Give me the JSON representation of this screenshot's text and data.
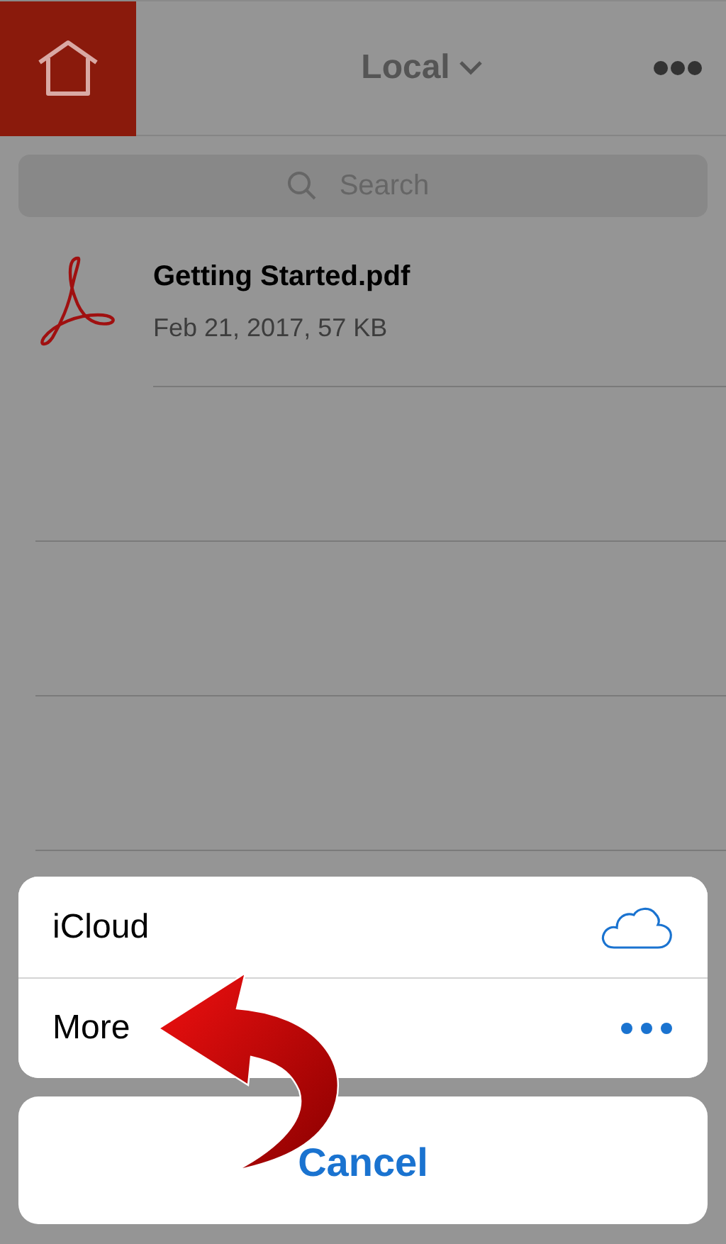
{
  "header": {
    "title": "Local"
  },
  "search": {
    "placeholder": "Search"
  },
  "files": [
    {
      "name": "Getting Started.pdf",
      "meta": "Feb 21, 2017, 57 KB"
    }
  ],
  "action_sheet": {
    "options": [
      {
        "label": "iCloud",
        "kind": "cloud"
      },
      {
        "label": "More",
        "kind": "more"
      }
    ],
    "cancel": "Cancel"
  }
}
